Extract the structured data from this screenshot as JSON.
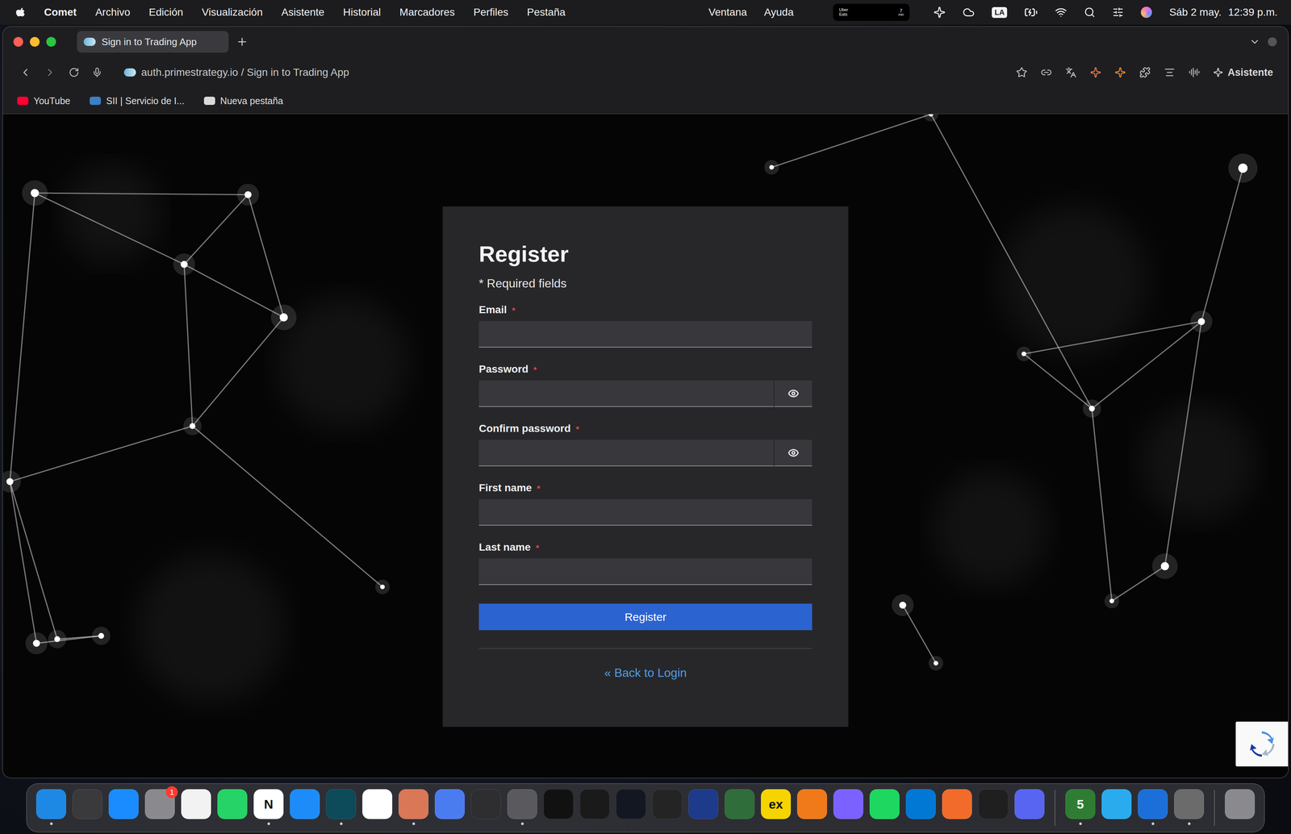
{
  "menu_bar": {
    "app": "Comet",
    "menus_left": [
      "Archivo",
      "Edición",
      "Visualización",
      "Asistente",
      "Historial",
      "Marcadores",
      "Perfiles",
      "Pestaña"
    ],
    "menus_right": [
      "Ventana",
      "Ayuda"
    ],
    "widget": {
      "brand": "Uber Eats",
      "eta": "7",
      "unit": "min"
    },
    "input_source": "LA",
    "date": "Sáb 2 may.",
    "time": "12:39 p.m."
  },
  "tabs": [
    {
      "label": "Sign in to Trading App",
      "selected": true
    }
  ],
  "address_bar": {
    "url_text": "auth.primestrategy.io / Sign in to Trading App"
  },
  "assistant_button": "Asistente",
  "bookmarks": [
    {
      "label": "YouTube",
      "color": "#ff0033"
    },
    {
      "label": "SII | Servicio de I...",
      "color": "#3d7fc4"
    },
    {
      "label": "Nueva pestaña",
      "color": "#d9d9d9"
    }
  ],
  "form": {
    "title": "Register",
    "required_note": "* Required fields",
    "required_mark": "*",
    "fields": [
      {
        "label": "Email",
        "required": true,
        "kind": "text",
        "value": ""
      },
      {
        "label": "Password",
        "required": true,
        "kind": "password",
        "value": "",
        "password_visible": false
      },
      {
        "label": "Confirm password",
        "required": true,
        "kind": "password",
        "value": "",
        "password_visible": false
      },
      {
        "label": "First name",
        "required": true,
        "kind": "text",
        "value": ""
      },
      {
        "label": "Last name",
        "required": true,
        "kind": "text",
        "value": ""
      }
    ],
    "submit": "Register",
    "back_link": "« Back to Login"
  },
  "dock": [
    {
      "kind": "app",
      "color": "#1e88e5",
      "running": true
    },
    {
      "kind": "app",
      "color": "#3a3a3c",
      "running": false
    },
    {
      "kind": "app",
      "color": "#1a8cff",
      "running": false
    },
    {
      "kind": "app",
      "color": "#8a8a8e",
      "running": false,
      "badge": "1"
    },
    {
      "kind": "app",
      "color": "#f2f2f2",
      "running": false
    },
    {
      "kind": "app",
      "color": "#25d366",
      "running": false
    },
    {
      "kind": "app",
      "color": "#ffffff",
      "running": true,
      "glyph": "N"
    },
    {
      "kind": "app",
      "color": "#1d8cf8",
      "running": false
    },
    {
      "kind": "app",
      "color": "#0d4a5a",
      "running": true
    },
    {
      "kind": "app",
      "color": "#ffffff",
      "running": false
    },
    {
      "kind": "app",
      "color": "#d97757",
      "running": true
    },
    {
      "kind": "app",
      "color": "#4a7cf0",
      "running": false
    },
    {
      "kind": "app",
      "color": "#2e2e30",
      "running": false
    },
    {
      "kind": "app",
      "color": "#5a5a5e",
      "running": true
    },
    {
      "kind": "app",
      "color": "#111111",
      "running": false
    },
    {
      "kind": "app",
      "color": "#1a1a1a",
      "running": false
    },
    {
      "kind": "app",
      "color": "#131722",
      "running": false
    },
    {
      "kind": "app",
      "color": "#242424",
      "running": false
    },
    {
      "kind": "app",
      "color": "#1e3a8a",
      "running": false
    },
    {
      "kind": "app",
      "color": "#2f6d3a",
      "running": false
    },
    {
      "kind": "app",
      "color": "#f5d400",
      "running": false,
      "glyph": "ex"
    },
    {
      "kind": "app",
      "color": "#f07a1a",
      "running": false
    },
    {
      "kind": "app",
      "color": "#7b61ff",
      "running": false
    },
    {
      "kind": "app",
      "color": "#1ed760",
      "running": false
    },
    {
      "kind": "app",
      "color": "#0078d4",
      "running": false
    },
    {
      "kind": "app",
      "color": "#f26b2a",
      "running": false
    },
    {
      "kind": "app",
      "color": "#1f1f1f",
      "running": false
    },
    {
      "kind": "app",
      "color": "#5865f2",
      "running": false
    },
    {
      "kind": "separator"
    },
    {
      "kind": "app",
      "color": "#2e7d32",
      "running": true,
      "glyph": "5"
    },
    {
      "kind": "app",
      "color": "#2aabee",
      "running": false
    },
    {
      "kind": "app",
      "color": "#1c6fd8",
      "running": true
    },
    {
      "kind": "app",
      "color": "#6b6b6b",
      "running": true
    },
    {
      "kind": "separator"
    },
    {
      "kind": "app",
      "color": "#8a8a8e",
      "running": false
    }
  ]
}
